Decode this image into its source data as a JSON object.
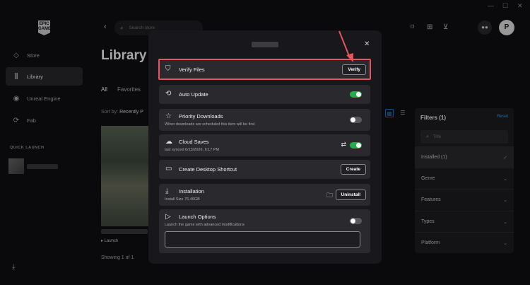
{
  "window": {
    "minimize": "—",
    "maximize": "☐",
    "close": "✕"
  },
  "sidebar": {
    "logo": "EPIC GAMES",
    "items": [
      {
        "label": "Store",
        "icon": "tag-icon"
      },
      {
        "label": "Library",
        "icon": "library-icon",
        "active": true
      },
      {
        "label": "Unreal Engine",
        "icon": "unreal-icon"
      },
      {
        "label": "Fab",
        "icon": "fab-icon"
      }
    ],
    "quick_launch_title": "QUICK LAUNCH"
  },
  "topbar": {
    "search_placeholder": "Search store",
    "avatar_letter": "P"
  },
  "library": {
    "title": "Library",
    "tabs": [
      "All",
      "Favorites"
    ],
    "sort_label": "Sort by:",
    "sort_value": "Recently P",
    "tile_launch": "▸ Launch",
    "showing": "Showing 1 of 1"
  },
  "filters": {
    "title": "Filters (1)",
    "reset": "Reset",
    "search_placeholder": "Title",
    "rows": [
      {
        "label": "Installed (1)",
        "chevron": "✓",
        "selected": true
      },
      {
        "label": "Genre",
        "chevron": "⌄"
      },
      {
        "label": "Features",
        "chevron": "⌄"
      },
      {
        "label": "Types",
        "chevron": "⌄"
      },
      {
        "label": "Platform",
        "chevron": "⌄"
      }
    ]
  },
  "modal": {
    "close": "✕",
    "options": {
      "verify": {
        "label": "Verify Files",
        "button": "Verify"
      },
      "auto_update": {
        "label": "Auto Update",
        "toggle": true
      },
      "priority": {
        "label": "Priority Downloads",
        "sub": "When downloads are scheduled this item will be first",
        "toggle": false
      },
      "cloud": {
        "label": "Cloud Saves",
        "sub": "last synced 6/13/2026, 6:17 PM",
        "toggle": true
      },
      "shortcut": {
        "label": "Create Desktop Shortcut",
        "button": "Create"
      },
      "installation": {
        "label": "Installation",
        "sub": "Install Size 76.46GB",
        "button": "Uninstall"
      },
      "launch": {
        "label": "Launch Options",
        "sub": "Launch the game with advanced modifications",
        "toggle": false,
        "input_value": ""
      }
    }
  },
  "colors": {
    "accent": "#1c7cd5",
    "toggle_on": "#20b04a",
    "highlight": "#e8545c"
  }
}
